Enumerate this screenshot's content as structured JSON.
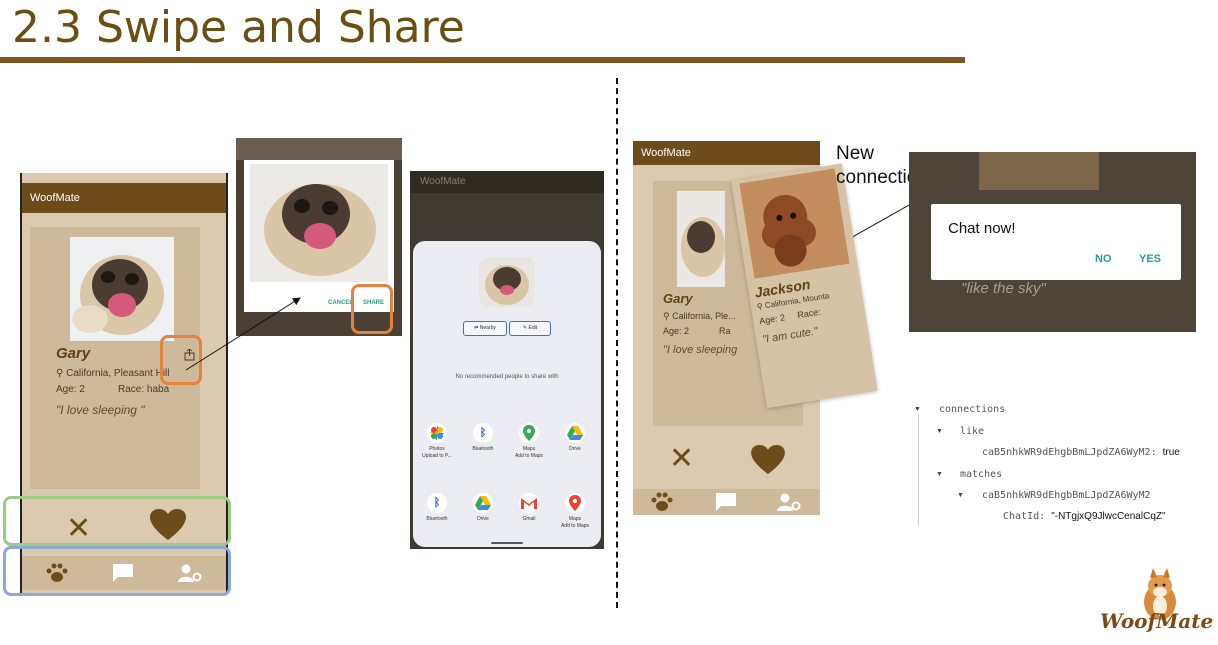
{
  "slide": {
    "title": "2.3 Swipe and Share"
  },
  "phone1": {
    "app_title": "WoofMate",
    "name": "Gary",
    "location": "California, Pleasant Hill",
    "age": "Age:  2",
    "race": "Race:  haba",
    "quote": "\"I love sleeping \"",
    "icons": [
      "paw-icon",
      "chat-icon",
      "user-settings-icon",
      "share-icon",
      "close-icon",
      "heart-icon"
    ]
  },
  "share_dialog": {
    "cancel": "CANCEL",
    "share": "SHARE"
  },
  "share_sheet": {
    "app_title": "WoofMate",
    "nearby": "Nearby",
    "edit": "Edit",
    "no_recommended": "No recommended people to share with",
    "apps": [
      {
        "label": "Photos",
        "sub": "Upload to P..."
      },
      {
        "label": "Bluetooth",
        "sub": ""
      },
      {
        "label": "Maps",
        "sub": "Add to Maps"
      },
      {
        "label": "Drive",
        "sub": ""
      },
      {
        "label": "Bluetooth",
        "sub": ""
      },
      {
        "label": "Drive",
        "sub": ""
      },
      {
        "label": "Gmail",
        "sub": ""
      },
      {
        "label": "Maps",
        "sub": "Add to Maps"
      }
    ]
  },
  "phone2": {
    "app_title": "WoofMate",
    "gary_name": "Gary",
    "gary_location": "California, Ple...",
    "gary_age": "Age:  2",
    "gary_race": "Ra",
    "gary_quote": "\"I love sleeping",
    "jackson_name": "Jackson",
    "jackson_location": "California, Mounta",
    "jackson_age": "Age:  2",
    "jackson_race": "Race:",
    "jackson_quote": "\"I am cute.\""
  },
  "annotation": {
    "line1": "New",
    "line2": "connection"
  },
  "chat_dialog": {
    "title": "Chat now!",
    "no": "NO",
    "yes": "YES",
    "background_quote": "\"like the sky\""
  },
  "db_tree": {
    "root": "connections",
    "like": "like",
    "like_key": "caB5nhkWR9dEhgbBmLJpdZA6WyM2:",
    "like_value": "true",
    "matches": "matches",
    "match_key": "caB5nhkWR9dEhgbBmLJpdZA6WyM2",
    "chat_key": "ChatId:",
    "chat_value": "\"-NTgjxQ9JlwcCenalCqZ\""
  },
  "logo": {
    "text": "WoofMate"
  },
  "colors": {
    "brown": "#6d4c1a",
    "beige": "#dccab0",
    "teal": "#2a9d8f",
    "orange": "#e8813a",
    "green": "#9ccc82",
    "blue": "#8ea7d6"
  }
}
